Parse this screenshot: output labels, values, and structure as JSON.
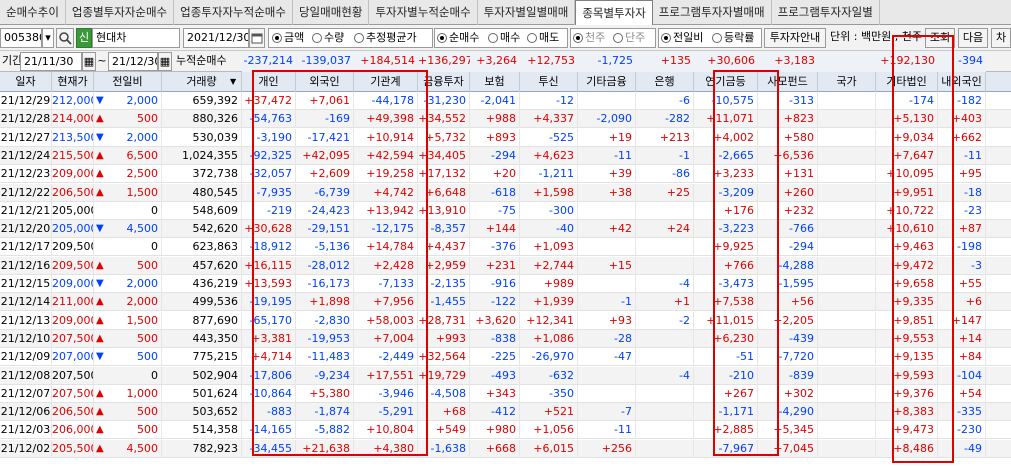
{
  "tabs": [
    "순매수추이",
    "업종별투자자순매수",
    "업종투자자누적순매수",
    "당일매매현황",
    "투자자별누적순매수",
    "투자자별일별매매",
    "종목별투자자",
    "프로그램투자자별매매",
    "프로그램투자자일별"
  ],
  "active_tab": 6,
  "toolbar": {
    "code": "005380",
    "stock_badge": "신",
    "stock_name": "현대차",
    "date": "2021/12/30",
    "unit_options": [
      "금액",
      "수량",
      "추정평균가"
    ],
    "trade_options": [
      "순매수",
      "매수",
      "매도"
    ],
    "share_options": [
      "천주",
      "단주"
    ],
    "compare_options": [
      "전일비",
      "등락률"
    ],
    "investor_guide": "투자자안내",
    "unit_label": "단위 : 백만원 , 천주",
    "query_button": "조회",
    "next_button": "다음",
    "chart_button": "차"
  },
  "period": {
    "label": "기간",
    "from": "21/11/30",
    "sep": "~",
    "to": "21/12/30",
    "cumulative_label": "누적순매수",
    "values": [
      "-237,214",
      "-139,037",
      "+184,514",
      "+136,297",
      "+3,264",
      "+12,753",
      "-1,725",
      "+135",
      "+30,606",
      "+3,183",
      "",
      "+192,130",
      "-394"
    ]
  },
  "headers": [
    "일자",
    "현재가",
    "전일비",
    "거래량",
    "개인",
    "외국인",
    "기관계",
    "금융투자",
    "보험",
    "투신",
    "기타금융",
    "은행",
    "연기금등",
    "사모펀드",
    "국가",
    "기타법인",
    "내외국인"
  ],
  "rows": [
    [
      "21/12/29",
      "212,000",
      "down",
      "2,000",
      "659,392",
      "+37,472",
      "+7,061",
      "-44,178",
      "-31,230",
      "-2,041",
      "-12",
      "",
      "-6",
      "-10,575",
      "-313",
      "",
      "-174",
      "-182"
    ],
    [
      "21/12/28",
      "214,000",
      "up",
      "500",
      "880,326",
      "-54,763",
      "-169",
      "+49,398",
      "+34,552",
      "+988",
      "+4,337",
      "-2,090",
      "-282",
      "+11,071",
      "+823",
      "",
      "+5,130",
      "+403"
    ],
    [
      "21/12/27",
      "213,500",
      "down",
      "2,000",
      "530,039",
      "-3,190",
      "-17,421",
      "+10,914",
      "+5,732",
      "+893",
      "-525",
      "+19",
      "+213",
      "+4,002",
      "+580",
      "",
      "+9,034",
      "+662"
    ],
    [
      "21/12/24",
      "215,500",
      "up",
      "6,500",
      "1,024,355",
      "-92,325",
      "+42,095",
      "+42,594",
      "+34,405",
      "-294",
      "+4,623",
      "-11",
      "-1",
      "-2,665",
      "+6,536",
      "",
      "+7,647",
      "-11"
    ],
    [
      "21/12/23",
      "209,000",
      "up",
      "2,500",
      "372,738",
      "-32,057",
      "+2,609",
      "+19,258",
      "+17,132",
      "+20",
      "-1,211",
      "+39",
      "-86",
      "+3,233",
      "+131",
      "",
      "+10,095",
      "+95"
    ],
    [
      "21/12/22",
      "206,500",
      "up",
      "1,500",
      "480,545",
      "-7,935",
      "-6,739",
      "+4,742",
      "+6,648",
      "-618",
      "+1,598",
      "+38",
      "+25",
      "-3,209",
      "+260",
      "",
      "+9,951",
      "-18"
    ],
    [
      "21/12/21",
      "205,000",
      "flat",
      "0",
      "548,609",
      "-219",
      "-24,423",
      "+13,942",
      "+13,910",
      "-75",
      "-300",
      "",
      "",
      "+176",
      "+232",
      "",
      "+10,722",
      "-23"
    ],
    [
      "21/12/20",
      "205,000",
      "down",
      "4,500",
      "542,620",
      "+30,628",
      "-29,151",
      "-12,175",
      "-8,357",
      "+144",
      "-40",
      "+42",
      "+24",
      "-3,223",
      "-766",
      "",
      "+10,610",
      "+87"
    ],
    [
      "21/12/17",
      "209,500",
      "flat",
      "0",
      "623,863",
      "-18,912",
      "-5,136",
      "+14,784",
      "+4,437",
      "-376",
      "+1,093",
      "",
      "",
      "+9,925",
      "-294",
      "",
      "+9,463",
      "-198"
    ],
    [
      "21/12/16",
      "209,500",
      "up",
      "500",
      "457,620",
      "+16,115",
      "-28,012",
      "+2,428",
      "+2,959",
      "+231",
      "+2,744",
      "+15",
      "",
      "+766",
      "-4,288",
      "",
      "+9,472",
      "-3"
    ],
    [
      "21/12/15",
      "209,000",
      "down",
      "2,000",
      "436,219",
      "+13,593",
      "-16,173",
      "-7,133",
      "-2,135",
      "-916",
      "+989",
      "",
      "-4",
      "-3,473",
      "-1,595",
      "",
      "+9,658",
      "+55"
    ],
    [
      "21/12/14",
      "211,000",
      "up",
      "2,000",
      "499,536",
      "-19,195",
      "+1,898",
      "+7,956",
      "-1,455",
      "-122",
      "+1,939",
      "-1",
      "+1",
      "+7,538",
      "+56",
      "",
      "+9,335",
      "+6"
    ],
    [
      "21/12/13",
      "209,000",
      "up",
      "1,500",
      "877,690",
      "-65,170",
      "-2,830",
      "+58,003",
      "+28,731",
      "+3,620",
      "+12,341",
      "+93",
      "-2",
      "+11,015",
      "+2,205",
      "",
      "+9,851",
      "+147"
    ],
    [
      "21/12/10",
      "207,500",
      "up",
      "500",
      "443,350",
      "+3,381",
      "-19,953",
      "+7,004",
      "+993",
      "-838",
      "+1,086",
      "-28",
      "",
      "+6,230",
      "-439",
      "",
      "+9,553",
      "+14"
    ],
    [
      "21/12/09",
      "207,000",
      "down",
      "500",
      "775,215",
      "+4,714",
      "-11,483",
      "-2,449",
      "+32,564",
      "-225",
      "-26,970",
      "-47",
      "",
      "-51",
      "-7,720",
      "",
      "+9,135",
      "+84"
    ],
    [
      "21/12/08",
      "207,500",
      "flat",
      "0",
      "502,904",
      "-17,806",
      "-9,234",
      "+17,551",
      "+19,729",
      "-493",
      "-632",
      "",
      "-4",
      "-210",
      "-839",
      "",
      "+9,593",
      "-104"
    ],
    [
      "21/12/07",
      "207,500",
      "up",
      "1,000",
      "501,624",
      "-10,864",
      "+5,380",
      "-3,946",
      "-4,508",
      "+343",
      "-350",
      "",
      "",
      "+267",
      "+302",
      "",
      "+9,376",
      "+54"
    ],
    [
      "21/12/06",
      "206,500",
      "up",
      "500",
      "503,652",
      "-883",
      "-1,874",
      "-5,291",
      "+68",
      "-412",
      "+521",
      "-7",
      "",
      "-1,171",
      "-4,290",
      "",
      "+8,383",
      "-335"
    ],
    [
      "21/12/03",
      "206,000",
      "up",
      "500",
      "514,358",
      "-14,165",
      "-5,882",
      "+10,804",
      "+549",
      "+980",
      "+1,056",
      "-11",
      "",
      "+2,885",
      "+5,345",
      "",
      "+9,473",
      "-230"
    ],
    [
      "21/12/02",
      "205,500",
      "up",
      "4,500",
      "782,923",
      "-34,455",
      "+21,638",
      "+4,380",
      "-1,638",
      "+668",
      "+6,015",
      "+256",
      "",
      "-7,967",
      "+7,045",
      "",
      "+8,486",
      "-49"
    ]
  ],
  "colors": {
    "up": "#e00000",
    "down": "#0040ff",
    "highlight": "#e00000"
  }
}
